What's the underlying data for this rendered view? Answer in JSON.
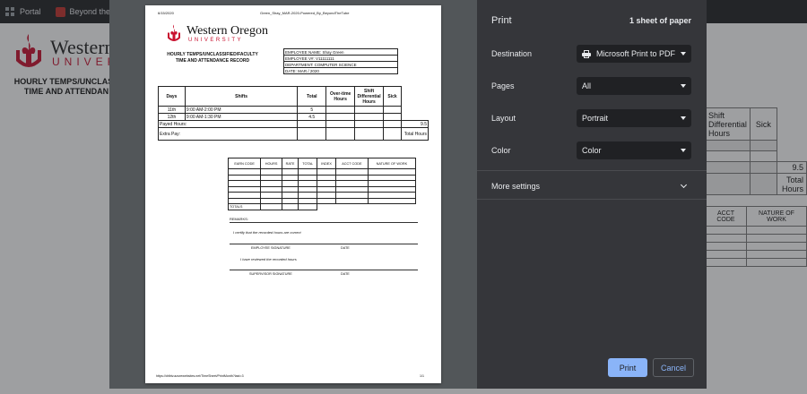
{
  "bookmarks": [
    {
      "label": "Portal",
      "icon": "grid-icon"
    },
    {
      "label": "Beyond the Tu",
      "icon": "youtube-icon"
    }
  ],
  "background_page": {
    "logo_text": "Western",
    "logo_sub": "UNIVEF",
    "heading_line1": "HOURLY TEMPS/UNCLASS",
    "heading_line2": "TIME AND ATTENDAN",
    "right_table": {
      "headers": [
        "Shift Differential Hours",
        "Sick"
      ],
      "paid_hours": "9.5",
      "total_label": "Total Hours",
      "acct_code": "ACCT CODE",
      "nature_of_work": "NATURE OF WORK"
    }
  },
  "preview": {
    "header_date": "6/15/2020",
    "header_file": "Green_Shay_MAR-2020-Powered_By_BeyondTheTube",
    "logo_text": "Western Oregon",
    "logo_sub": "UNIVERSITY",
    "title_line1": "HOURLY TEMPS/UNCLASSIFIED/FACULTY",
    "title_line2": "TIME AND ATTENDANCE RECORD",
    "employee": {
      "name": "EMPLOYEE NAME: Shay Green",
      "vnum": "EMPLOYEE V#: V11111111",
      "department": "DEPARTMENT: COMPUTER SCIENCE",
      "date": "DATE: MAR / 2020"
    },
    "table": {
      "headers": [
        "Days",
        "Shifts",
        "Total",
        "Over-time Hours",
        "Shift Differential Hours",
        "Sick"
      ],
      "rows": [
        {
          "day": "11th",
          "shift": "9:00 AM-2:00 PM",
          "total": "5"
        },
        {
          "day": "12th",
          "shift": "9:00 AM-1:30 PM",
          "total": "4.5"
        }
      ],
      "payed_label": "Payed Hours:",
      "payed_value": "9.5",
      "extra_label": "Extra Pay:",
      "total_hours_label": "Total Hours"
    },
    "earn_headers": [
      "EARN CODE",
      "HOURS",
      "RATE",
      "TOTAL",
      "INDEX",
      "ACCT CODE",
      "NATURE OF WORK"
    ],
    "earn_totals": "TOTALS",
    "remarks": "REMARKS:",
    "certify": "I certify that the recorded hours are correct",
    "employee_signature": "EMPLOYEE SIGNATURE",
    "date_label": "DATE",
    "reviewed": "I have reviewed the recorded hours",
    "supervisor_signature": "SUPERVISOR SIGNATURE",
    "footer_url": "https://drlbtv.azurewebsites.net/TimeSheet/PrintMonth?last=3",
    "footer_page": "1/1"
  },
  "print_panel": {
    "title": "Print",
    "sheets": "1 sheet of paper",
    "destination_label": "Destination",
    "destination_value": "Microsoft Print to PDF",
    "pages_label": "Pages",
    "pages_value": "All",
    "layout_label": "Layout",
    "layout_value": "Portrait",
    "color_label": "Color",
    "color_value": "Color",
    "more_settings": "More settings",
    "print_button": "Print",
    "cancel_button": "Cancel"
  },
  "colors": {
    "panel_bg": "#35363a",
    "select_bg": "#202124",
    "accent": "#8ab4f8",
    "brand_red": "#c8102e"
  }
}
